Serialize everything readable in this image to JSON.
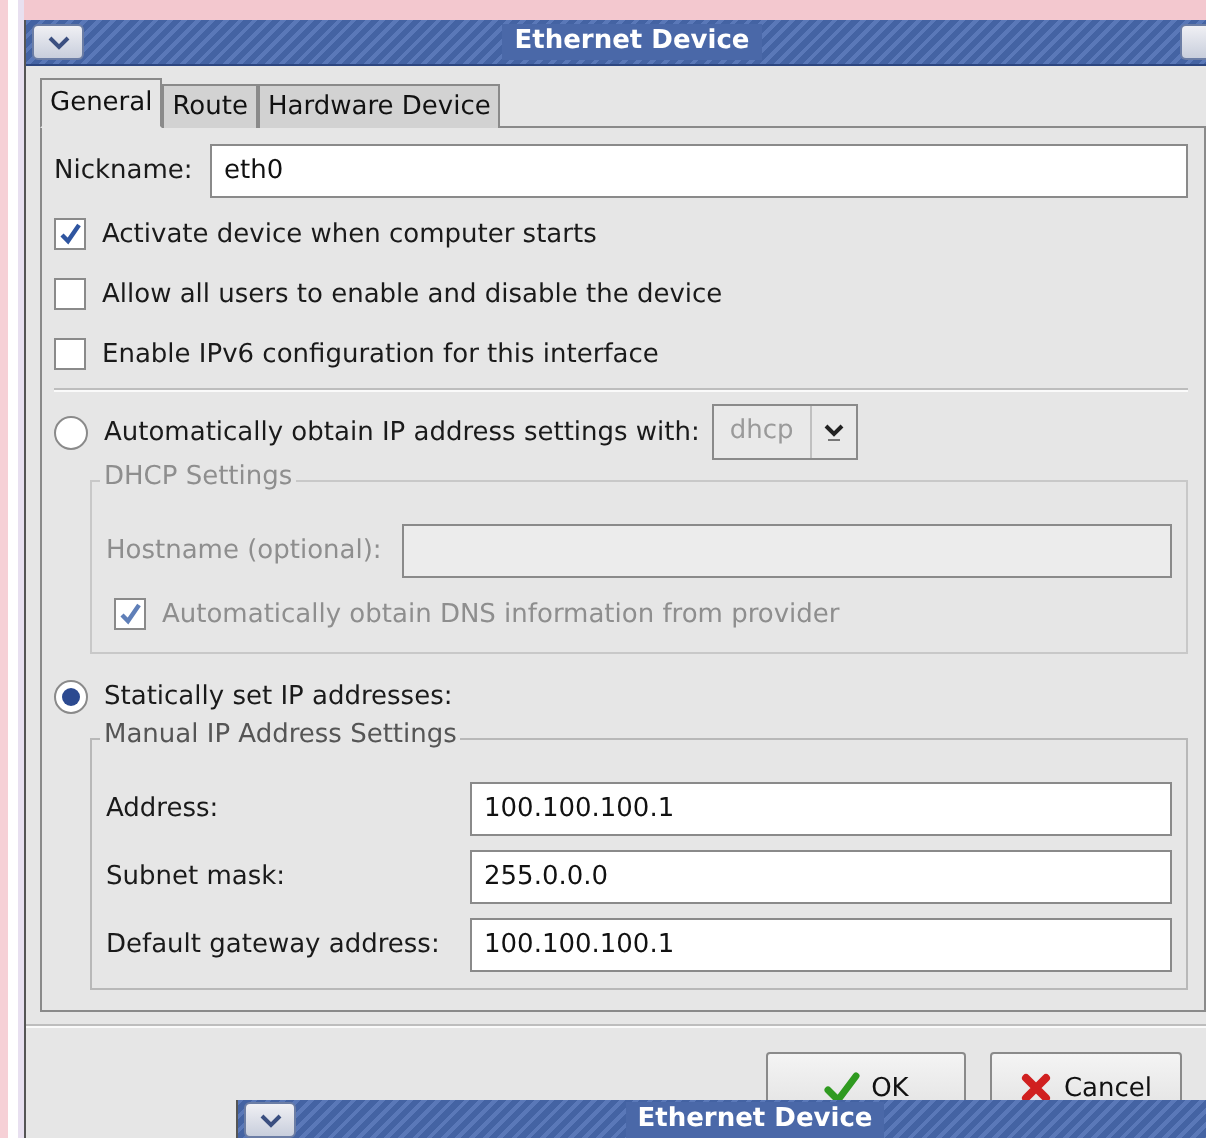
{
  "window": {
    "title": "Ethernet Device"
  },
  "tabs": [
    {
      "label": "General",
      "selected": true
    },
    {
      "label": "Route",
      "selected": false
    },
    {
      "label": "Hardware Device",
      "selected": false
    }
  ],
  "nickname": {
    "label": "Nickname:",
    "value": "eth0"
  },
  "options": [
    {
      "label": "Activate device when computer starts",
      "checked": true
    },
    {
      "label": "Allow all users to enable and disable the device",
      "checked": false
    },
    {
      "label": "Enable IPv6 configuration for this interface",
      "checked": false
    }
  ],
  "automatic": {
    "label": "Automatically obtain IP address settings with:",
    "selected": false,
    "protocol": "dhcp"
  },
  "dhcp_settings": {
    "title": "DHCP Settings",
    "disabled": true,
    "hostname_label": "Hostname (optional):",
    "dns": {
      "label": "Automatically obtain DNS information from provider",
      "checked": true
    }
  },
  "static": {
    "label": "Statically set IP addresses:",
    "selected": true
  },
  "manual_settings": {
    "title": "Manual IP Address Settings",
    "fields": [
      {
        "label": "Address:",
        "value": "100.100.100.1"
      },
      {
        "label": "Subnet mask:",
        "value": "255.0.0.0"
      },
      {
        "label": "Default gateway address:",
        "value": "100.100.100.1"
      }
    ]
  },
  "buttons": [
    {
      "label": "OK",
      "kind": "ok"
    },
    {
      "label": "Cancel",
      "kind": "cancel"
    }
  ],
  "background_window": {
    "title": "Ethernet Device"
  }
}
